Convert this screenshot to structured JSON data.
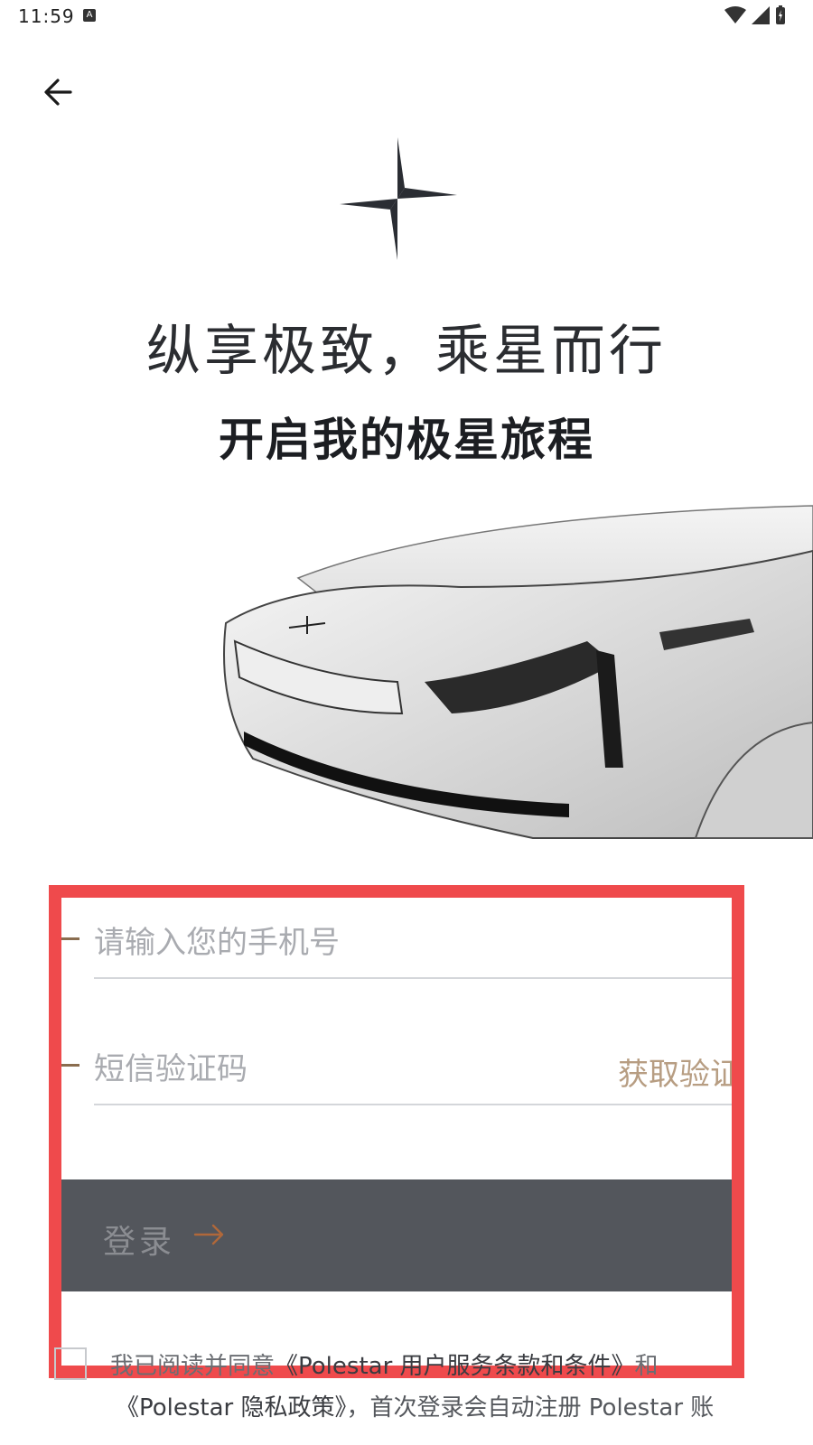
{
  "status_bar": {
    "time": "11:59",
    "notification_icon": "A"
  },
  "header": {
    "back_icon": "arrow-left-icon"
  },
  "brand": {
    "logo": "polestar-star-icon",
    "slogan": "纵享极致，乘星而行",
    "subtitle": "开启我的极星旅程"
  },
  "form": {
    "phone_placeholder": "请输入您的手机号",
    "code_placeholder": "短信验证码",
    "get_code_label": "获取验证码",
    "login_label": "登录"
  },
  "agreement": {
    "line1_prefix": "我已阅读并同意",
    "terms_link": "《Polestar 用户服务条款和条件》",
    "line1_suffix": "和",
    "privacy_link": "《Polestar 隐私政策》",
    "line2_suffix": "，首次登录会自动注册 Polestar 账"
  },
  "colors": {
    "accent": "#b79d82",
    "button_bg": "#53565c",
    "highlight_border": "#ef4a4c"
  }
}
